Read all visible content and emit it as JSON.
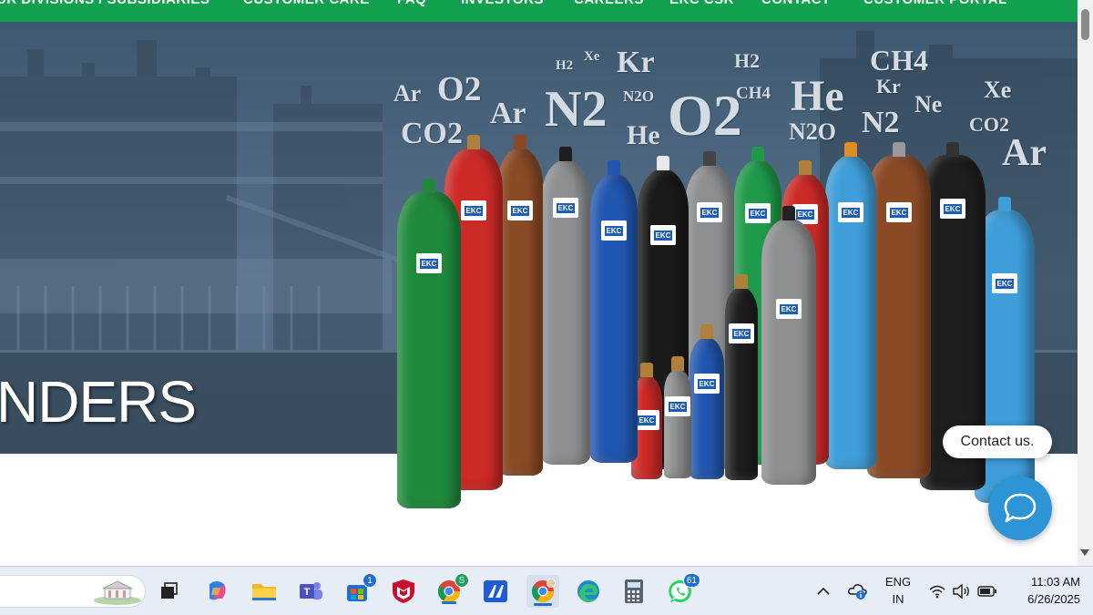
{
  "nav": {
    "items": [
      "UR DIVISIONS / SUBSIDIARIES",
      "CUSTOMER CARE",
      "FAQ",
      "INVESTORS",
      "CAREERS",
      "EKC CSR",
      "CONTACT",
      "CUSTOMER PORTAL"
    ]
  },
  "hero": {
    "headline": "NDERS",
    "formulas": [
      "Ar",
      "O2",
      "CO2",
      "Ar",
      "H2",
      "Xe",
      "Kr",
      "N2",
      "N2O",
      "He",
      "O2",
      "H2",
      "CH4",
      "He",
      "N2O",
      "CH4",
      "Kr",
      "Ne",
      "N2",
      "Xe",
      "CO2",
      "Ar"
    ],
    "cylinder_brand": "EKC"
  },
  "contact": {
    "label": "Contact us."
  },
  "taskbar": {
    "badges": {
      "store": "1",
      "chrome_profile": "S",
      "whatsapp": "61"
    },
    "language": "ENG",
    "region": "IN",
    "time": "11:03 AM",
    "date": "6/26/2025"
  },
  "colors": {
    "nav_green": "#11a14e",
    "chat_blue": "#2d94d6",
    "taskbar_bg": "#e7edf7"
  }
}
